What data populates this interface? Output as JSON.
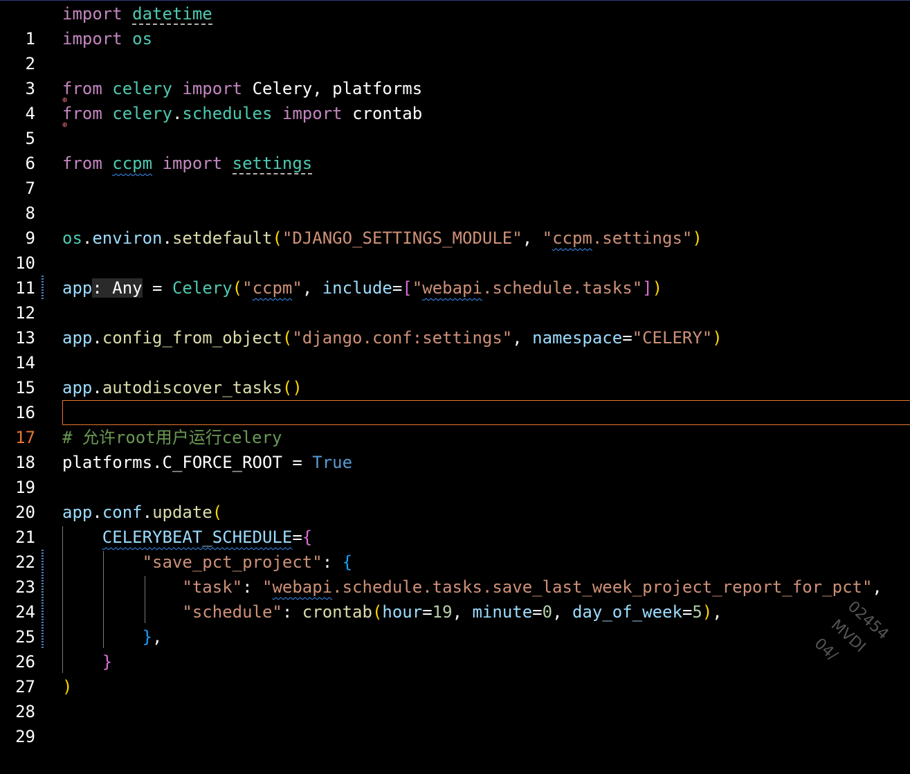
{
  "editor": {
    "active_line": "17",
    "line_numbers": [
      "1",
      "2",
      "3",
      "4",
      "5",
      "6",
      "7",
      "8",
      "9",
      "10",
      "11",
      "12",
      "13",
      "14",
      "15",
      "16",
      "17",
      "18",
      "19",
      "20",
      "21",
      "22",
      "23",
      "24",
      "25",
      "26",
      "27",
      "28",
      "29"
    ],
    "code": {
      "l1": [
        "import",
        "datetime"
      ],
      "l2": [
        "import",
        "os"
      ],
      "l4": [
        "from",
        "celery",
        "import",
        "Celery, platforms"
      ],
      "l5": [
        "from",
        "celery",
        ".",
        "schedules",
        "import",
        "crontab"
      ],
      "l7": [
        "from",
        "ccpm",
        "import",
        "settings"
      ],
      "l10": [
        "os",
        ".",
        "environ",
        ".",
        "setdefault",
        "(",
        "\"DJANGO_SETTINGS_MODULE\"",
        ", ",
        "\"",
        "ccpm",
        ".settings\"",
        ")"
      ],
      "l12": [
        "app",
        ": Any",
        " = ",
        "Celery",
        "(",
        "\"",
        "ccpm",
        "\"",
        ", ",
        "include",
        "=",
        "[",
        "\"",
        "webapi",
        ".schedule.tasks\"",
        "]",
        ")"
      ],
      "l14": [
        "app",
        ".",
        "config_from_object",
        "(",
        "\"django.conf:settings\"",
        ", ",
        "namespace",
        "=",
        "\"CELERY\"",
        ")"
      ],
      "l16": [
        "app",
        ".",
        "autodiscover_tasks",
        "()"
      ],
      "l18": [
        "# 允许root用户运行celery"
      ],
      "l19": [
        "platforms",
        ".C_FORCE_ROOT",
        " = ",
        "True"
      ],
      "l21": [
        "app",
        ".",
        "conf",
        ".",
        "update",
        "("
      ],
      "l22": [
        "CELERYBEAT_SCHEDULE",
        "=",
        "{"
      ],
      "l23": [
        "\"save_pct_project\"",
        ": ",
        "{"
      ],
      "l24": [
        "\"task\"",
        ": ",
        "\"",
        "webapi",
        ".schedule.tasks.save_last_week_project_report_for_pct\"",
        ","
      ],
      "l25": [
        "\"schedule\"",
        ": ",
        "crontab",
        "(",
        "hour",
        "=",
        "19",
        ", ",
        "minute",
        "=",
        "0",
        ", ",
        "day_of_week",
        "=",
        "5",
        ")",
        ","
      ],
      "l26": [
        "}",
        ","
      ],
      "l27": [
        "}"
      ],
      "l28": [
        ")"
      ]
    },
    "watermark": "02454\nMVDI\n04/"
  },
  "colors": {
    "background": "#000000",
    "keyword": "#c586c0",
    "module": "#4ec9b0",
    "variable": "#9cdcfe",
    "function": "#dcdcaa",
    "string": "#ce9178",
    "number": "#b5cea8",
    "comment": "#6a9955",
    "constant": "#569cd6",
    "active_line_border": "#e8772e"
  }
}
